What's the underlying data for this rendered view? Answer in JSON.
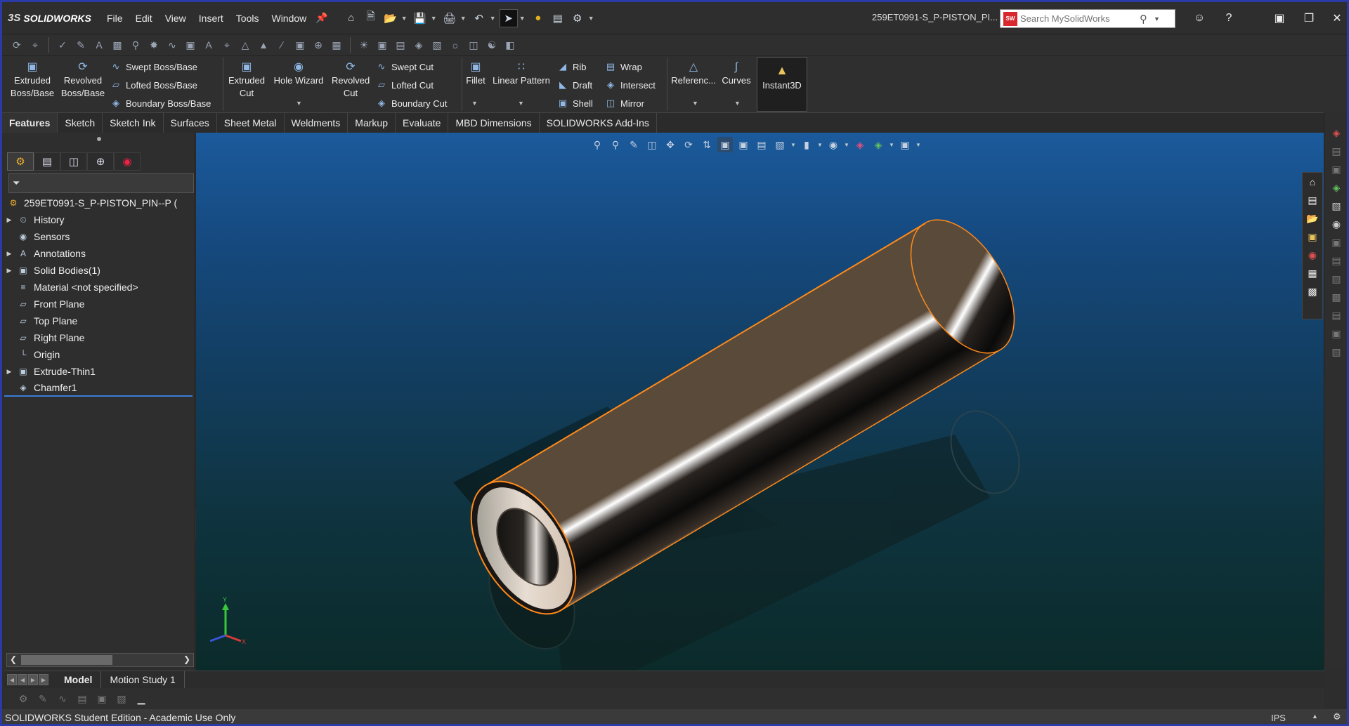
{
  "app": {
    "brand": "SOLIDWORKS",
    "brand_mark": "3S",
    "document_title": "259ET0991-S_P-PISTON_PI..."
  },
  "menu": [
    "File",
    "Edit",
    "View",
    "Insert",
    "Tools",
    "Window"
  ],
  "search": {
    "placeholder": "Search MySolidWorks",
    "logo_text": "SW"
  },
  "command_manager": {
    "extruded_boss": "Extruded Boss/Base",
    "revolved_boss": "Revolved Boss/Base",
    "swept_boss": "Swept Boss/Base",
    "lofted_boss": "Lofted Boss/Base",
    "boundary_boss": "Boundary Boss/Base",
    "extruded_cut": "Extruded Cut",
    "hole_wizard": "Hole Wizard",
    "revolved_cut": "Revolved Cut",
    "swept_cut": "Swept Cut",
    "lofted_cut": "Lofted Cut",
    "boundary_cut": "Boundary Cut",
    "fillet": "Fillet",
    "linear_pattern": "Linear Pattern",
    "rib": "Rib",
    "draft": "Draft",
    "shell": "Shell",
    "wrap": "Wrap",
    "intersect": "Intersect",
    "mirror": "Mirror",
    "reference": "Referenc...",
    "curves": "Curves",
    "instant3d": "Instant3D"
  },
  "tabs": [
    "Features",
    "Sketch",
    "Sketch Ink",
    "Surfaces",
    "Sheet Metal",
    "Weldments",
    "Markup",
    "Evaluate",
    "MBD Dimensions",
    "SOLIDWORKS Add-Ins"
  ],
  "active_tab": "Features",
  "feature_tree": {
    "root": "259ET0991-S_P-PISTON_PIN--P  (",
    "items": [
      {
        "label": "History",
        "expandable": true,
        "icon": "history-icon"
      },
      {
        "label": "Sensors",
        "expandable": false,
        "icon": "sensor-icon"
      },
      {
        "label": "Annotations",
        "expandable": true,
        "icon": "annotation-icon"
      },
      {
        "label": "Solid Bodies(1)",
        "expandable": true,
        "icon": "solid-body-icon"
      },
      {
        "label": "Material <not specified>",
        "expandable": false,
        "icon": "material-icon"
      },
      {
        "label": "Front Plane",
        "expandable": false,
        "icon": "plane-icon"
      },
      {
        "label": "Top Plane",
        "expandable": false,
        "icon": "plane-icon"
      },
      {
        "label": "Right Plane",
        "expandable": false,
        "icon": "plane-icon"
      },
      {
        "label": "Origin",
        "expandable": false,
        "icon": "origin-icon"
      },
      {
        "label": "Extrude-Thin1",
        "expandable": true,
        "icon": "extrude-icon"
      },
      {
        "label": "Chamfer1",
        "expandable": false,
        "icon": "chamfer-icon"
      }
    ]
  },
  "bottom_tabs": [
    "Model",
    "Motion Study 1"
  ],
  "status": {
    "edition": "SOLIDWORKS Student Edition - Academic Use Only",
    "units": "IPS"
  },
  "triad": {
    "y": "Y",
    "x": "X"
  },
  "colors": {
    "accent_blue": "#3a7bd5",
    "frame_border": "#2a3ba8",
    "viewport_top": "#1b5a9c",
    "viewport_bottom": "#0b2b2a",
    "part_highlight": "#ff8a1a"
  }
}
